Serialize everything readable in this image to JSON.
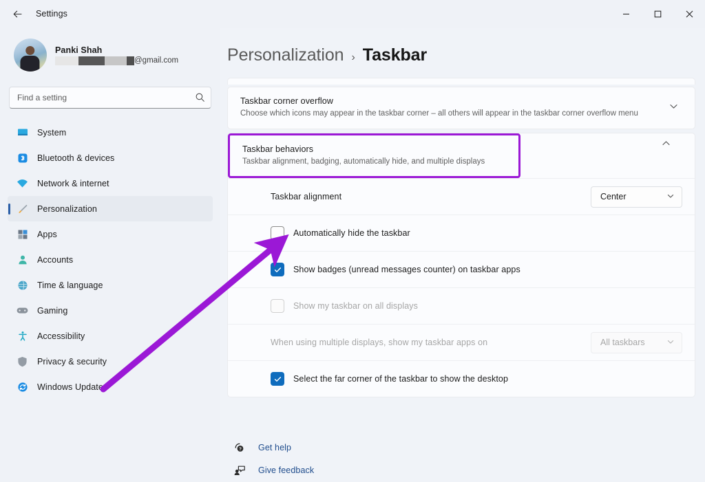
{
  "window": {
    "title": "Settings",
    "back_icon": "back-arrow-icon",
    "minimize_label": "Minimize",
    "maximize_label": "Maximize",
    "close_label": "Close"
  },
  "account": {
    "name": "Panki Shah",
    "email_suffix": "@gmail.com",
    "email_redacted": true
  },
  "search": {
    "placeholder": "Find a setting",
    "value": "",
    "icon": "search-icon"
  },
  "sidebar": {
    "items": [
      {
        "label": "System",
        "icon": "monitor-icon",
        "active": false
      },
      {
        "label": "Bluetooth & devices",
        "icon": "bluetooth-icon",
        "active": false
      },
      {
        "label": "Network & internet",
        "icon": "wifi-icon",
        "active": false
      },
      {
        "label": "Personalization",
        "icon": "paintbrush-icon",
        "active": true
      },
      {
        "label": "Apps",
        "icon": "apps-icon",
        "active": false
      },
      {
        "label": "Accounts",
        "icon": "person-icon",
        "active": false
      },
      {
        "label": "Time & language",
        "icon": "clock-globe-icon",
        "active": false
      },
      {
        "label": "Gaming",
        "icon": "gamepad-icon",
        "active": false
      },
      {
        "label": "Accessibility",
        "icon": "accessibility-icon",
        "active": false
      },
      {
        "label": "Privacy & security",
        "icon": "shield-icon",
        "active": false
      },
      {
        "label": "Windows Update",
        "icon": "update-icon",
        "active": false
      }
    ]
  },
  "breadcrumb": {
    "parent": "Personalization",
    "separator": "›",
    "current": "Taskbar"
  },
  "cards": {
    "corner_overflow": {
      "title": "Taskbar corner overflow",
      "subtitle": "Choose which icons may appear in the taskbar corner – all others will appear in the taskbar corner overflow menu",
      "chevron": "chevron-down-icon",
      "expanded": false
    },
    "behaviors": {
      "title": "Taskbar behaviors",
      "subtitle": "Taskbar alignment, badging, automatically hide, and multiple displays",
      "chevron": "chevron-up-icon",
      "expanded": true,
      "highlighted": true,
      "highlight_color": "#9B18D6"
    }
  },
  "settings_rows": [
    {
      "type": "combo",
      "label": "Taskbar alignment",
      "value": "Center",
      "disabled": false
    },
    {
      "type": "checkbox",
      "label": "Automatically hide the taskbar",
      "checked": false,
      "disabled": false
    },
    {
      "type": "checkbox",
      "label": "Show badges (unread messages counter) on taskbar apps",
      "checked": true,
      "disabled": false
    },
    {
      "type": "checkbox",
      "label": "Show my taskbar on all displays",
      "checked": false,
      "disabled": true
    },
    {
      "type": "combo",
      "label": "When using multiple displays, show my taskbar apps on",
      "value": "All taskbars",
      "disabled": true
    },
    {
      "type": "checkbox",
      "label": "Select the far corner of the taskbar to show the desktop",
      "checked": true,
      "disabled": false
    }
  ],
  "footer_links": [
    {
      "label": "Get help",
      "icon": "help-question-icon"
    },
    {
      "label": "Give feedback",
      "icon": "feedback-icon"
    }
  ],
  "colors": {
    "accent_checkbox": "#0F6CBD",
    "annotation": "#9B18D6",
    "link": "#1F4C8C",
    "sidebar_bg": "#EFF2F7",
    "selection_bar": "#2B5FA8"
  }
}
